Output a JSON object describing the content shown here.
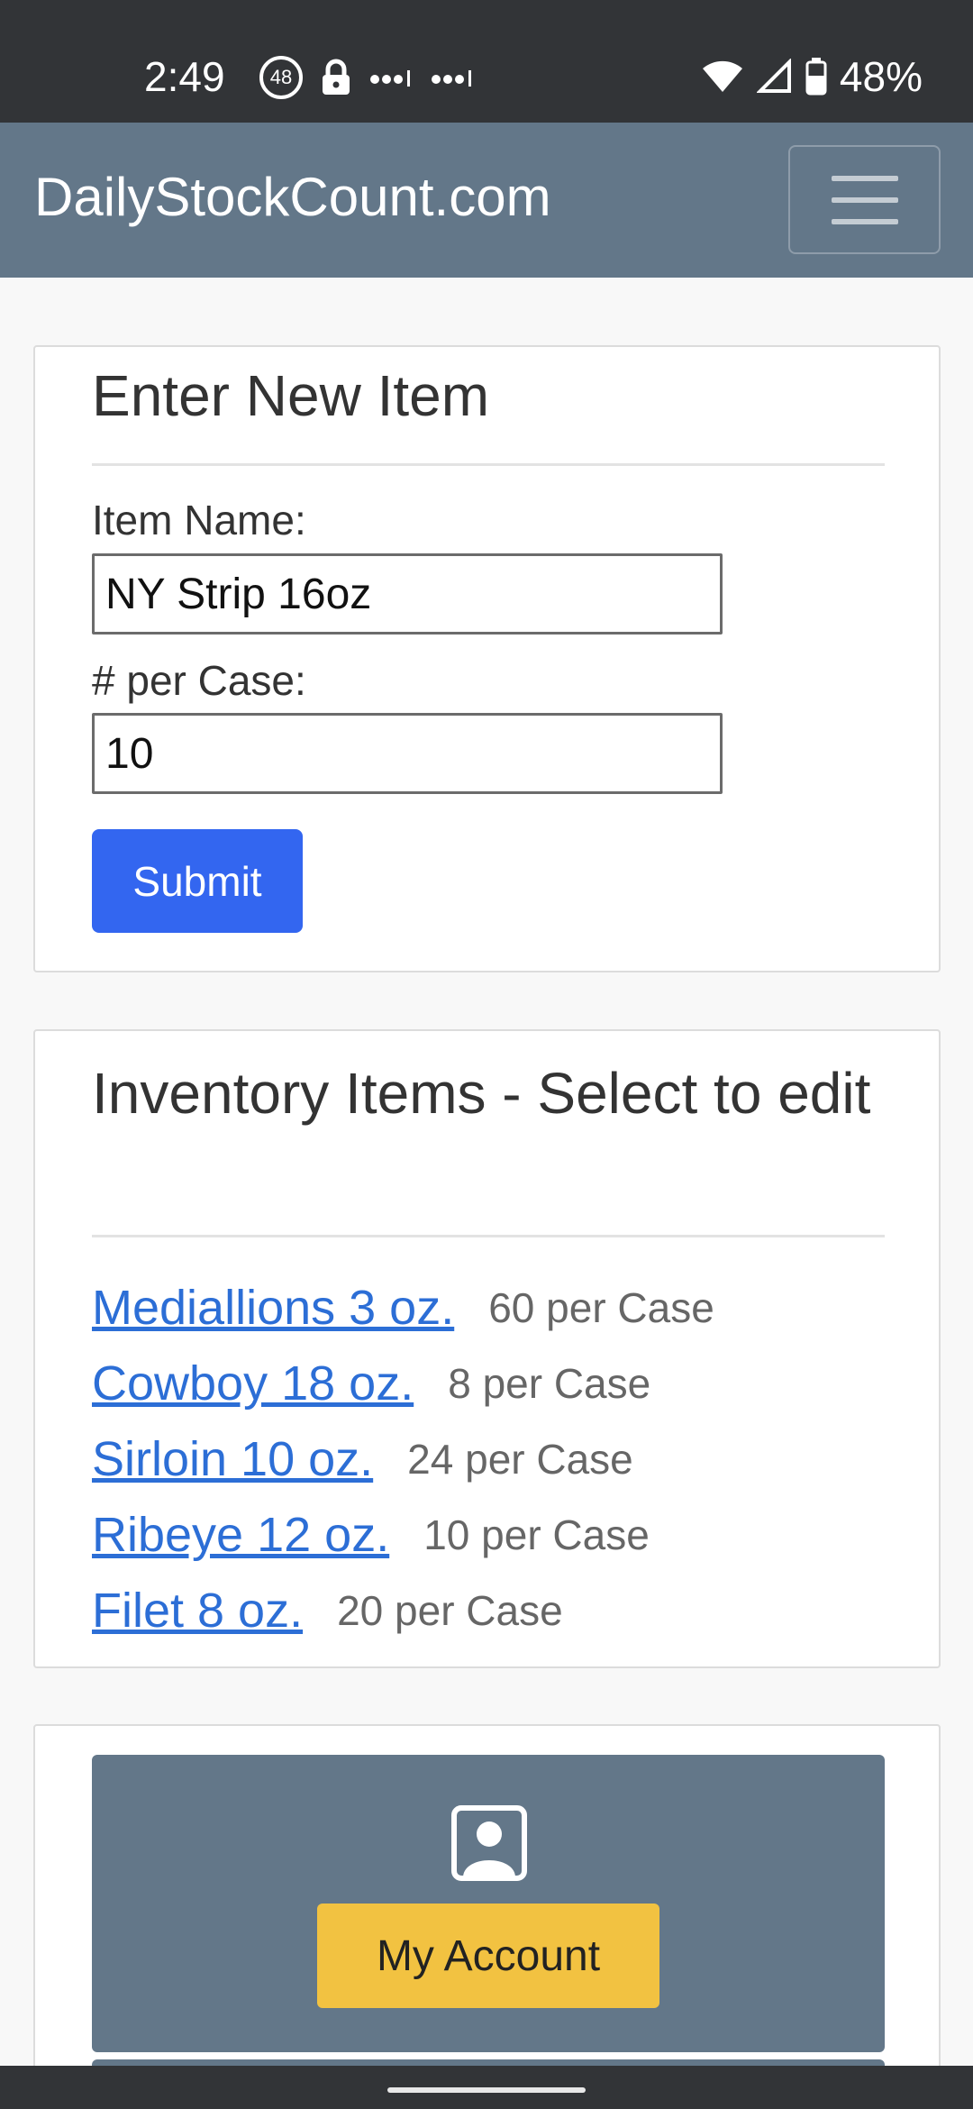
{
  "status_bar": {
    "time": "2:49",
    "notification_badge": "48",
    "battery": "48%",
    "icons": [
      "badge-icon",
      "lock-icon",
      "signal-dots-icon",
      "signal-dots-icon",
      "wifi-icon",
      "cell-signal-icon",
      "battery-icon"
    ]
  },
  "navbar": {
    "brand": "DailyStockCount.com",
    "menu_icon": "hamburger-menu-icon",
    "background": "#637789"
  },
  "new_item": {
    "title": "Enter New Item",
    "item_name_label": "Item Name:",
    "item_name_value": "NY Strip 16oz",
    "per_case_label": "# per Case:",
    "per_case_value": "10",
    "submit_label": "Submit",
    "submit_color": "#3366f0"
  },
  "inventory": {
    "title": "Inventory Items - Select to edit",
    "items": [
      {
        "name": "Mediallions 3 oz.",
        "qty": "60 per Case"
      },
      {
        "name": "Cowboy 18 oz.",
        "qty": "8 per Case"
      },
      {
        "name": "Sirloin 10 oz.",
        "qty": "24 per Case"
      },
      {
        "name": "Ribeye 12 oz.",
        "qty": "10 per Case"
      },
      {
        "name": "Filet 8 oz.",
        "qty": "20 per Case"
      }
    ],
    "link_color": "#2c6ed6"
  },
  "account": {
    "icon": "user-portrait-icon",
    "button_label": "My Account",
    "button_color": "#f2c241"
  }
}
